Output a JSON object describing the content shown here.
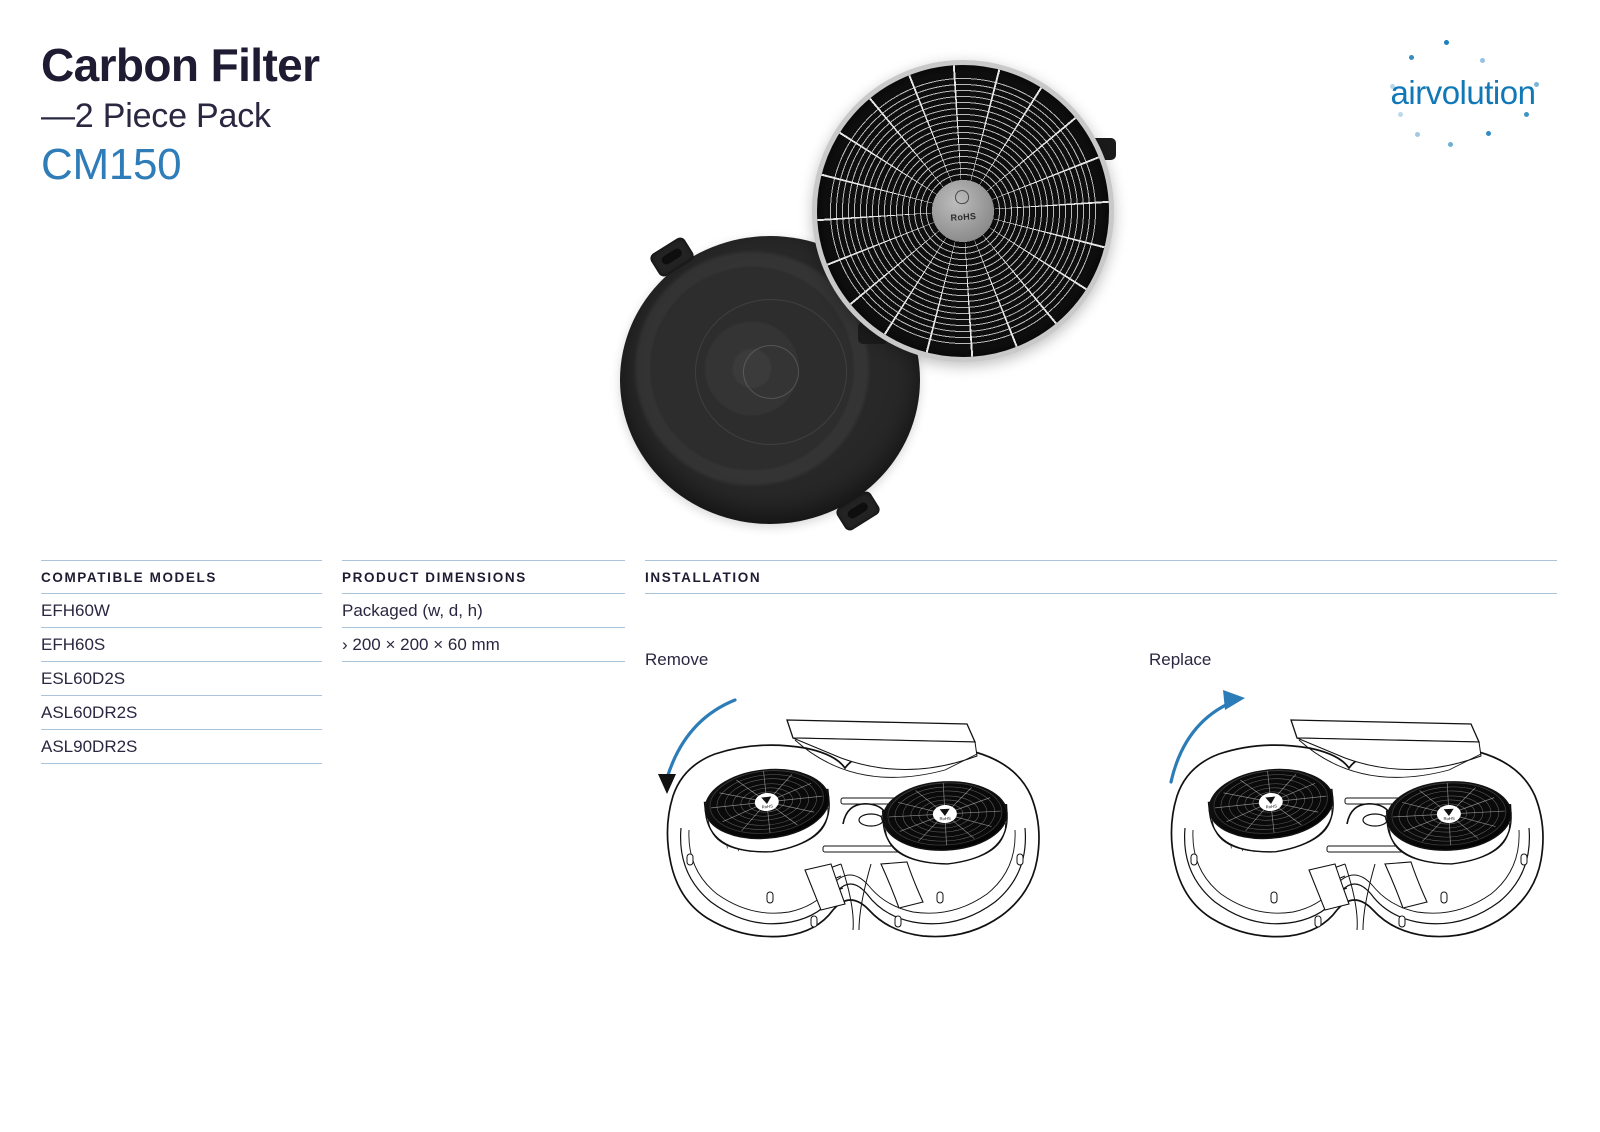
{
  "header": {
    "title": "Carbon Filter",
    "subtitle": "—2 Piece Pack",
    "code": "CM150"
  },
  "brand": {
    "name": "airvolution",
    "color": "#1178b8"
  },
  "hero": {
    "alt": "two round carbon filters, one grille side up, one felt side up",
    "rohs_label": "RoHS"
  },
  "compatible_models": {
    "heading": "COMPATIBLE MODELS",
    "items": [
      "EFH60W",
      "EFH60S",
      "ESL60D2S",
      "ASL60DR2S",
      "ASL90DR2S"
    ]
  },
  "product_dimensions": {
    "heading": "PRODUCT DIMENSIONS",
    "rows": [
      "Packaged (w, d, h)",
      "› 200 × 200 × 60 mm"
    ]
  },
  "installation": {
    "heading": "INSTALLATION",
    "steps": [
      {
        "label": "Remove",
        "arrow": "arc-arrow-down-left"
      },
      {
        "label": "Replace",
        "arrow": "arc-arrow-up-right"
      }
    ]
  },
  "colors": {
    "ink": "#1e1b33",
    "accent_blue": "#2e7cb8",
    "rule_blue": "#a9c4dc",
    "arrow_blue": "#2c7cb8"
  }
}
